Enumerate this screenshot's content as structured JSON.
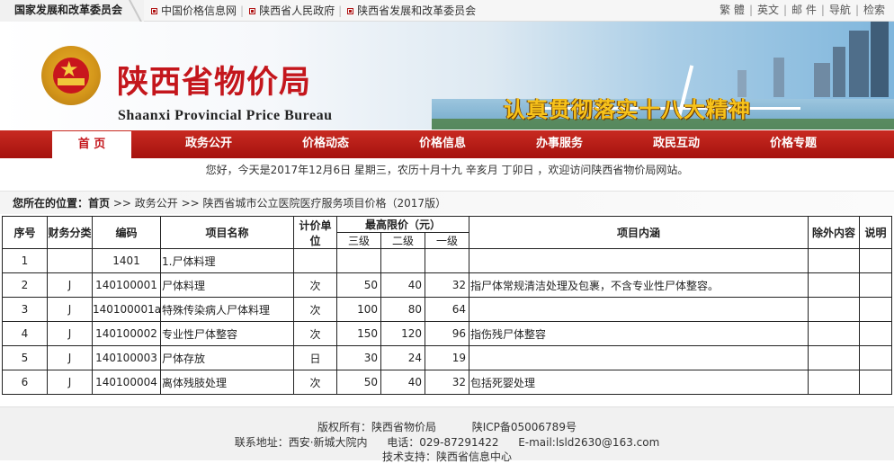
{
  "topbar": {
    "org": "国家发展和改革委员会",
    "links": [
      "中国价格信息网",
      "陕西省人民政府",
      "陕西省发展和改革委员会"
    ],
    "right_links": [
      "繁 體",
      "英文",
      "邮 件",
      "导航",
      "检索"
    ]
  },
  "header": {
    "title": "陕西省物价局",
    "subtitle": "Shaanxi Provincial Price Bureau",
    "slogan": "认真贯彻落实十八大精神"
  },
  "nav": {
    "items": [
      "首 页",
      "政务公开",
      "价格动态",
      "价格信息",
      "办事服务",
      "政民互动",
      "价格专题"
    ]
  },
  "date_line": "您好，今天是2017年12月6日 星期三，农历十月十九 辛亥月 丁卯日 ，欢迎访问陕西省物价局网站。",
  "breadcrumb": {
    "prefix": "您所在的位置：",
    "home": "首页",
    "path": ">> 政务公开 >> 陕西省城市公立医院医疗服务项目价格（2017版）"
  },
  "table": {
    "headers": {
      "seq": "序号",
      "category": "财务分类",
      "code": "编码",
      "name": "项目名称",
      "unit": "计价单位",
      "max_price": "最高限价（元）",
      "level3": "三级",
      "level2": "二级",
      "level1": "一级",
      "content": "项目内涵",
      "exclusions": "除外内容",
      "note": "说明"
    },
    "rows": [
      {
        "seq": "1",
        "category": "",
        "code": "1401",
        "name": "1.尸体料理",
        "unit": "",
        "l3": "",
        "l2": "",
        "l1": "",
        "content": "",
        "exclusions": "",
        "note": ""
      },
      {
        "seq": "2",
        "category": "J",
        "code": "140100001",
        "name": "尸体料理",
        "unit": "次",
        "l3": "50",
        "l2": "40",
        "l1": "32",
        "content": "指尸体常规清洁处理及包裹，不含专业性尸体整容。",
        "exclusions": "",
        "note": ""
      },
      {
        "seq": "3",
        "category": "J",
        "code": "140100001a",
        "name": "特殊传染病人尸体料理",
        "unit": "次",
        "l3": "100",
        "l2": "80",
        "l1": "64",
        "content": "",
        "exclusions": "",
        "note": ""
      },
      {
        "seq": "4",
        "category": "J",
        "code": "140100002",
        "name": "专业性尸体整容",
        "unit": "次",
        "l3": "150",
        "l2": "120",
        "l1": "96",
        "content": "指伤残尸体整容",
        "exclusions": "",
        "note": ""
      },
      {
        "seq": "5",
        "category": "J",
        "code": "140100003",
        "name": "尸体存放",
        "unit": "日",
        "l3": "30",
        "l2": "24",
        "l1": "19",
        "content": "",
        "exclusions": "",
        "note": ""
      },
      {
        "seq": "6",
        "category": "J",
        "code": "140100004",
        "name": "离体残肢处理",
        "unit": "次",
        "l3": "50",
        "l2": "40",
        "l1": "32",
        "content": "包括死婴处理",
        "exclusions": "",
        "note": ""
      }
    ]
  },
  "footer": {
    "copyright": "版权所有：陕西省物价局",
    "icp": "陕ICP备05006789号",
    "address": "联系地址：西安·新城大院内",
    "phone": "电话：029-87291422",
    "email": "E-mail:lsld2630@163.com",
    "support": "技术支持：陕西省信息中心"
  },
  "colors": {
    "brand_red": "#c4161c",
    "nav_red": "#b51a14",
    "slogan_gold": "#f7c21a"
  }
}
